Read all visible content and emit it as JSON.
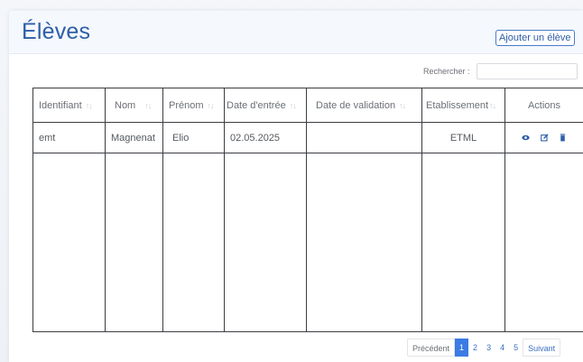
{
  "header": {
    "title": "Élèves",
    "add_button": "Ajouter un élève"
  },
  "search": {
    "label": "Rechercher :",
    "value": ""
  },
  "table": {
    "columns": [
      "Identifiant",
      "Nom",
      "Prénom",
      "Date d'entrée",
      "Date de validation",
      "Etablissement",
      "Actions"
    ],
    "rows": [
      {
        "identifiant": "emt",
        "nom": "Magnenat",
        "prenom": "Elio",
        "date_entree": "02.05.2025",
        "date_validation": "",
        "etablissement": "ETML"
      }
    ],
    "action_icons": [
      "eye-icon",
      "edit-icon",
      "trash-icon"
    ]
  },
  "pagination": {
    "previous": "Précédent",
    "pages": [
      "1",
      "2",
      "3",
      "4",
      "5"
    ],
    "active": "1",
    "next": "Suivant"
  },
  "colors": {
    "primary": "#2d5ea8",
    "active_page": "#3b7be3"
  }
}
